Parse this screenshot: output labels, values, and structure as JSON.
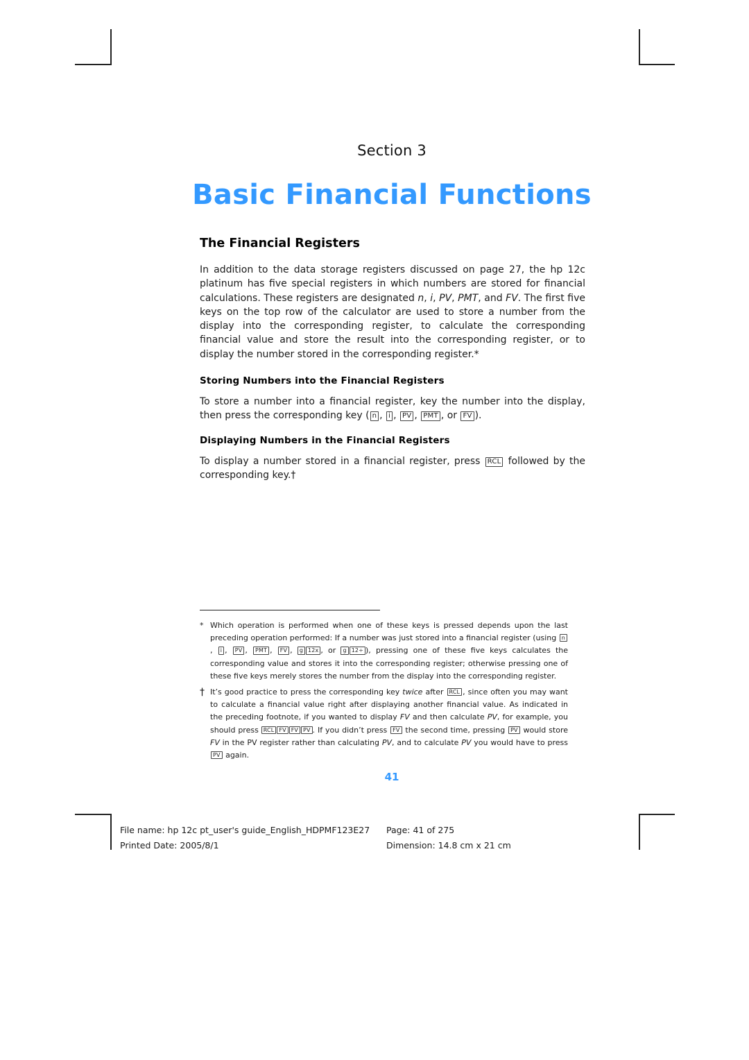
{
  "section_label": "Section 3",
  "title": "Basic Financial Functions",
  "title_color": "#3399ff",
  "heading_registers": "The Financial Registers",
  "intro": {
    "t1": "In addition to the data storage registers discussed on page 27, the hp 12c platinum has five special registers in which numbers are stored for financial calculations. These registers are designated ",
    "v_n": "n",
    "sep1": ", ",
    "v_i": "i",
    "sep2": ", ",
    "v_pv": "PV",
    "sep3": ", ",
    "v_pmt": "PMT",
    "sep4": ", and ",
    "v_fv": "FV",
    "t2": ". The first five keys on the top row of the calculator are used to store a number from the display into the corresponding register, to calculate the corresponding financial value and store the result into the corresponding register, or to display the number stored in the corresponding register.",
    "footnote_ref": "*"
  },
  "storing": {
    "heading": "Storing Numbers into the Financial Registers",
    "t1": "To store a number into a financial register, key the number into the display, then press the corresponding key (",
    "sep1": ", ",
    "sep2": ", ",
    "sep3": ", ",
    "sep4": ", or ",
    "t2": ")."
  },
  "displaying": {
    "heading": "Displaying Numbers in the Financial Registers",
    "t1": "To display a number stored in a financial register, press ",
    "t2": " followed by the corresponding key.",
    "footnote_ref": "†"
  },
  "keys": {
    "n": "n",
    "i": "i",
    "pv": "PV",
    "pmt": "PMT",
    "fv": "FV",
    "rcl": "RCL",
    "g": "g",
    "twelve_x": "12x",
    "twelve_div": "12÷"
  },
  "footnotes": [
    {
      "mark": "*",
      "t1": "Which operation is performed when one of these keys is pressed depends upon the last preceding operation performed: If a number was just stored into a financial register (using ",
      "sep1": ", ",
      "sep2": ", ",
      "sep3": ", ",
      "sep4": ", ",
      "sep5": ", ",
      "sep6": ", or ",
      "t2": "), pressing one of these five keys calculates the corresponding value and stores it into the corresponding register; otherwise pressing one of these five keys merely stores the number from the display into the corresponding register."
    },
    {
      "mark": "†",
      "t1": "It’s good practice to press the corresponding key ",
      "em_twice": "twice",
      "t2": " after ",
      "t3": ", since often you may want to calculate a financial value right after displaying another financial value. As indicated in the preceding footnote, if you wanted to display ",
      "v_fv1": "FV",
      "t4": " and then calculate ",
      "v_pv1": "PV",
      "t5": ", for example, you should press ",
      "t6": ". If you didn’t press ",
      "t7": " the second time, pressing ",
      "t8": " would store ",
      "v_fv2": "FV",
      "t9": " in the PV register rather than calculating ",
      "v_pv2": "PV",
      "t10": ", and to calculate ",
      "v_pv3": "PV",
      "t11": " you would have to press ",
      "t12": " again."
    }
  ],
  "page_number": "41",
  "footer": {
    "filename": "File name: hp 12c pt_user's guide_English_HDPMF123E27",
    "page": "Page: 41 of 275",
    "printed_date": "Printed Date: 2005/8/1",
    "dimension": "Dimension: 14.8 cm x 21 cm"
  }
}
